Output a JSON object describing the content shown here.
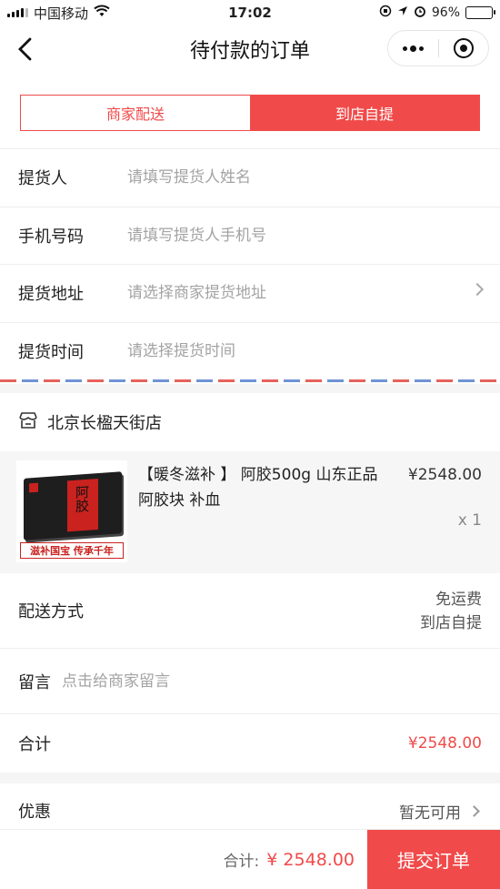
{
  "status_bar": {
    "carrier": "中国移动",
    "time": "17:02",
    "battery": "96%"
  },
  "nav": {
    "title": "待付款的订单"
  },
  "delivery_options": {
    "merchant": "商家配送",
    "pickup": "到店自提",
    "selected": "pickup"
  },
  "form": {
    "pickup_person": {
      "label": "提货人",
      "placeholder": "请填写提货人姓名"
    },
    "phone": {
      "label": "手机号码",
      "placeholder": "请填写提货人手机号"
    },
    "address": {
      "label": "提货地址",
      "placeholder": "请选择商家提货地址"
    },
    "time": {
      "label": "提货时间",
      "placeholder": "请选择提货时间"
    }
  },
  "store": {
    "name": "北京长楹天街店"
  },
  "product": {
    "title": "【暖冬滋补 】 阿胶500g 山东正品阿胶块 补血",
    "price": "¥2548.00",
    "quantity": "x 1",
    "image_box_text": "阿胶",
    "image_banner": "滋补国宝 传承千年"
  },
  "shipping": {
    "label": "配送方式",
    "line1": "免运费",
    "line2": "到店自提"
  },
  "note": {
    "label": "留言",
    "placeholder": "点击给商家留言"
  },
  "total": {
    "label": "合计",
    "value": "¥2548.00"
  },
  "coupon": {
    "label": "优惠",
    "value": "暂无可用"
  },
  "bottom_bar": {
    "total_label": "合计:",
    "total_value": "¥ 2548.00",
    "submit_label": "提交订单"
  },
  "colors": {
    "accent": "#f14a4a",
    "stripe_red": "#e5625c",
    "stripe_blue": "#6f93d6"
  }
}
